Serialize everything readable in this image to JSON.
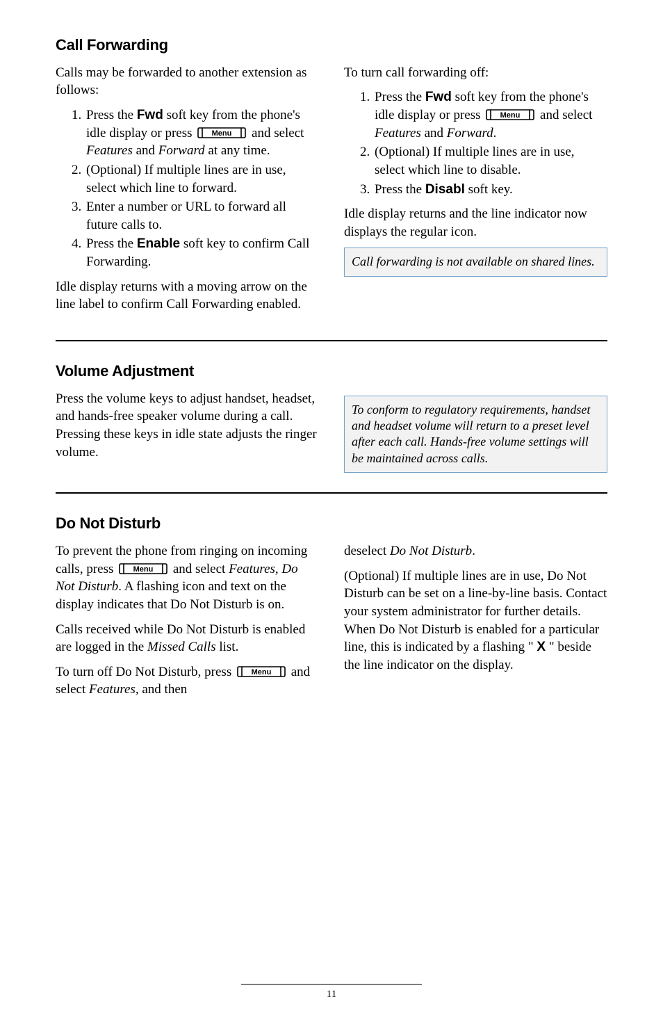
{
  "page_number": "11",
  "menu_label": "Menu",
  "label_fwd": "Fwd",
  "label_enable": "Enable",
  "label_disabl": "Disabl",
  "sections": {
    "call_forwarding": {
      "heading": "Call Forwarding",
      "left": {
        "intro": "Calls may be forwarded to another exten­sion as follows:",
        "step1_a": "Press the ",
        "step1_b": " soft key from the phone's idle display or press ",
        "step1_c": " and select ",
        "step1_features": "Features",
        "step1_d": " and ",
        "step1_forward": "Forward",
        "step1_e": " at any time.",
        "step2": "(Optional) If multiple lines are in use, select which line to forward.",
        "step3": "Enter a number or URL to forward all future calls to.",
        "step4_a": "Press the ",
        "step4_b": " soft key to confirm Call Forwarding.",
        "outro": "Idle display returns with a moving arrow on the line label to confirm Call Forward­ing enabled."
      },
      "right": {
        "intro": "To turn call forwarding off:",
        "step1_a": "Press the ",
        "step1_b": " soft key from the phone's idle display or press ",
        "step1_c": " and select ",
        "step1_features": "Features",
        "step1_d": " and ",
        "step1_forward": "Forward",
        "step1_e": ".",
        "step2": "(Optional) If multiple lines are in use, select which line to disable.",
        "step3_a": "Press the ",
        "step3_b": " soft key.",
        "outro": "Idle display returns and the line indicator now displays the regular icon.",
        "note": "Call forwarding is not available on shared lines."
      }
    },
    "volume": {
      "heading": "Volume Adjustment",
      "body": "Press the volume keys to adjust handset, headset, and hands-free speaker volume during a call.  Pressing these keys in idle state adjusts the ringer volume.",
      "note": "To conform to regulatory requirements, hand­set and headset volume will return to a preset level after each call.  Hands-free volume settings will be maintained across calls."
    },
    "dnd": {
      "heading": "Do Not Disturb",
      "left": {
        "p1_a": "To prevent the phone from ringing on incoming calls, press ",
        "p1_b": " and select ",
        "p1_features": "Features, Do Not Disturb",
        "p1_c": ".  A flashing icon and text on the display indicates that Do Not Disturb is on.",
        "p2_a": "Calls received while Do Not Disturb is enabled are logged in the ",
        "p2_missed": "Missed Calls",
        "p2_b": " list.",
        "p3_a": "To turn off Do Not Disturb, press ",
        "p3_b": " and select ",
        "p3_features": "Features,",
        "p3_c": " and then"
      },
      "right": {
        "p1_a": "deselect ",
        "p1_dnd": "Do Not Disturb",
        "p1_b": ".",
        "p2_a": "(Optional) If multiple lines are in use, Do Not Disturb can be set on a line-by-line basis.  Contact your system administrator for further details.  When Do Not Disturb is enabled for a particular line, this is indicated by a flashing \" ",
        "p2_x": "X",
        "p2_b": " \" beside the line indicator on the display."
      }
    }
  }
}
